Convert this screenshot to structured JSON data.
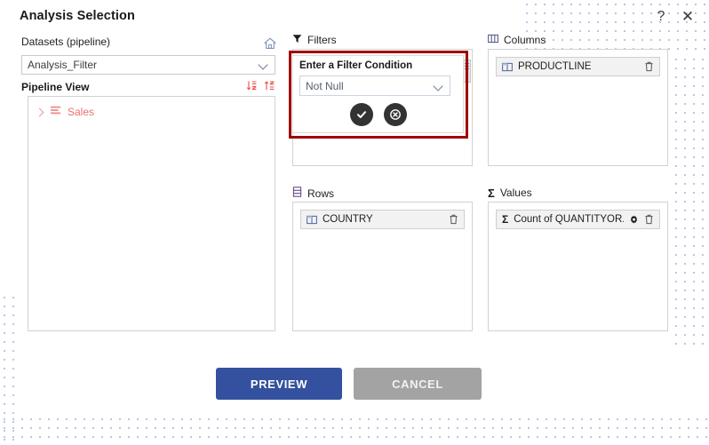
{
  "dialog": {
    "title": "Analysis Selection",
    "help_icon": "question-mark-icon",
    "close_icon": "close-icon"
  },
  "left_panel": {
    "datasets_label": "Datasets (pipeline)",
    "home_icon": "home-icon",
    "dataset_select": {
      "value": "Analysis_Filter",
      "chevron_icon": "chevron-down-icon"
    },
    "pipeline_label": "Pipeline View",
    "sort_desc_icon": "sort-descending-icon",
    "sort_asc_icon": "sort-ascending-icon",
    "tree": {
      "items": [
        {
          "label": "Sales",
          "expander_icon": "chevron-right-icon",
          "type_icon": "table-list-icon"
        }
      ]
    }
  },
  "panels": {
    "filters": {
      "label": "Filters",
      "icon": "funnel-icon",
      "chips": []
    },
    "columns": {
      "label": "Columns",
      "icon": "columns-icon",
      "chips": [
        {
          "text": "PRODUCTLINE",
          "field_icon": "column-field-icon",
          "delete_icon": "trash-icon"
        }
      ]
    },
    "rows": {
      "label": "Rows",
      "icon": "rows-icon",
      "chips": [
        {
          "text": "COUNTRY",
          "field_icon": "column-field-icon",
          "delete_icon": "trash-icon"
        }
      ]
    },
    "values": {
      "label": "Values",
      "icon": "sigma-icon",
      "chips": [
        {
          "text": "Count of QUANTITYOR...",
          "field_icon": "sigma-icon",
          "settings_icon": "gear-icon",
          "delete_icon": "trash-icon"
        }
      ]
    }
  },
  "filter_popup": {
    "label": "Enter a Filter Condition",
    "condition": {
      "value": "Not Null",
      "chevron_icon": "chevron-down-icon"
    },
    "confirm_icon": "check-icon",
    "cancel_icon": "x-circle-icon",
    "highlight_color": "#a00000"
  },
  "footer": {
    "preview_label": "PREVIEW",
    "cancel_label": "CANCEL",
    "preview_color": "#33519e",
    "cancel_color": "#a3a3a3"
  }
}
